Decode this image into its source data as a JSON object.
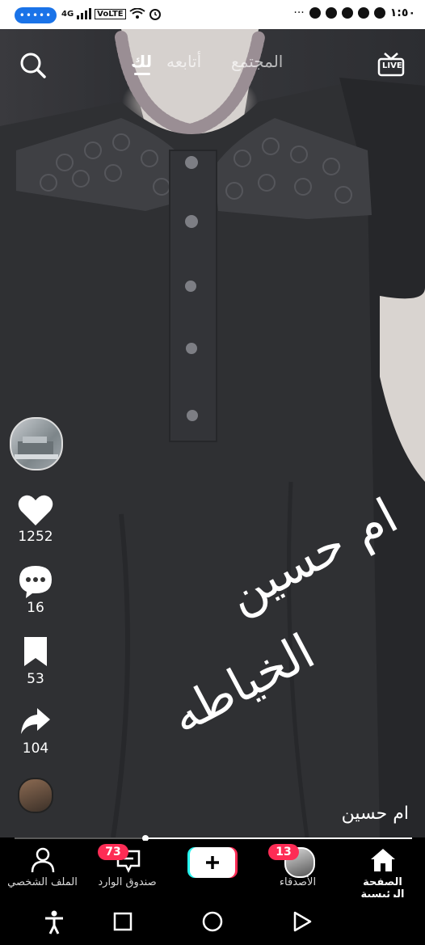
{
  "status_bar": {
    "pill_text": "•••••",
    "network": "4G",
    "volte": "VoLTE",
    "time": "١:٥٠",
    "more": "···"
  },
  "top_nav": {
    "tabs": [
      {
        "label": "المجتمع",
        "active": false
      },
      {
        "label": "أتابعه",
        "active": false
      },
      {
        "label": "لك",
        "active": true
      }
    ],
    "live_label": "LIVE"
  },
  "video": {
    "overlay_text_line1": "ام حسين",
    "overlay_text_line2": "الخياطه"
  },
  "actions": {
    "likes": "1252",
    "comments": "16",
    "saves": "53",
    "shares": "104"
  },
  "author": {
    "name": "ام حسين"
  },
  "playback": {
    "progress_fraction": 0.67
  },
  "bottom_nav": {
    "profile": "الملف الشخصي",
    "inbox": "صندوق الوارد",
    "inbox_badge": "73",
    "friends": "الأصدقاء",
    "friends_badge": "13",
    "home": "الصفحة الرئيسية"
  },
  "colors": {
    "accent": "#fe2c55",
    "cyan": "#25f4ee",
    "pill": "#1a73e8"
  }
}
